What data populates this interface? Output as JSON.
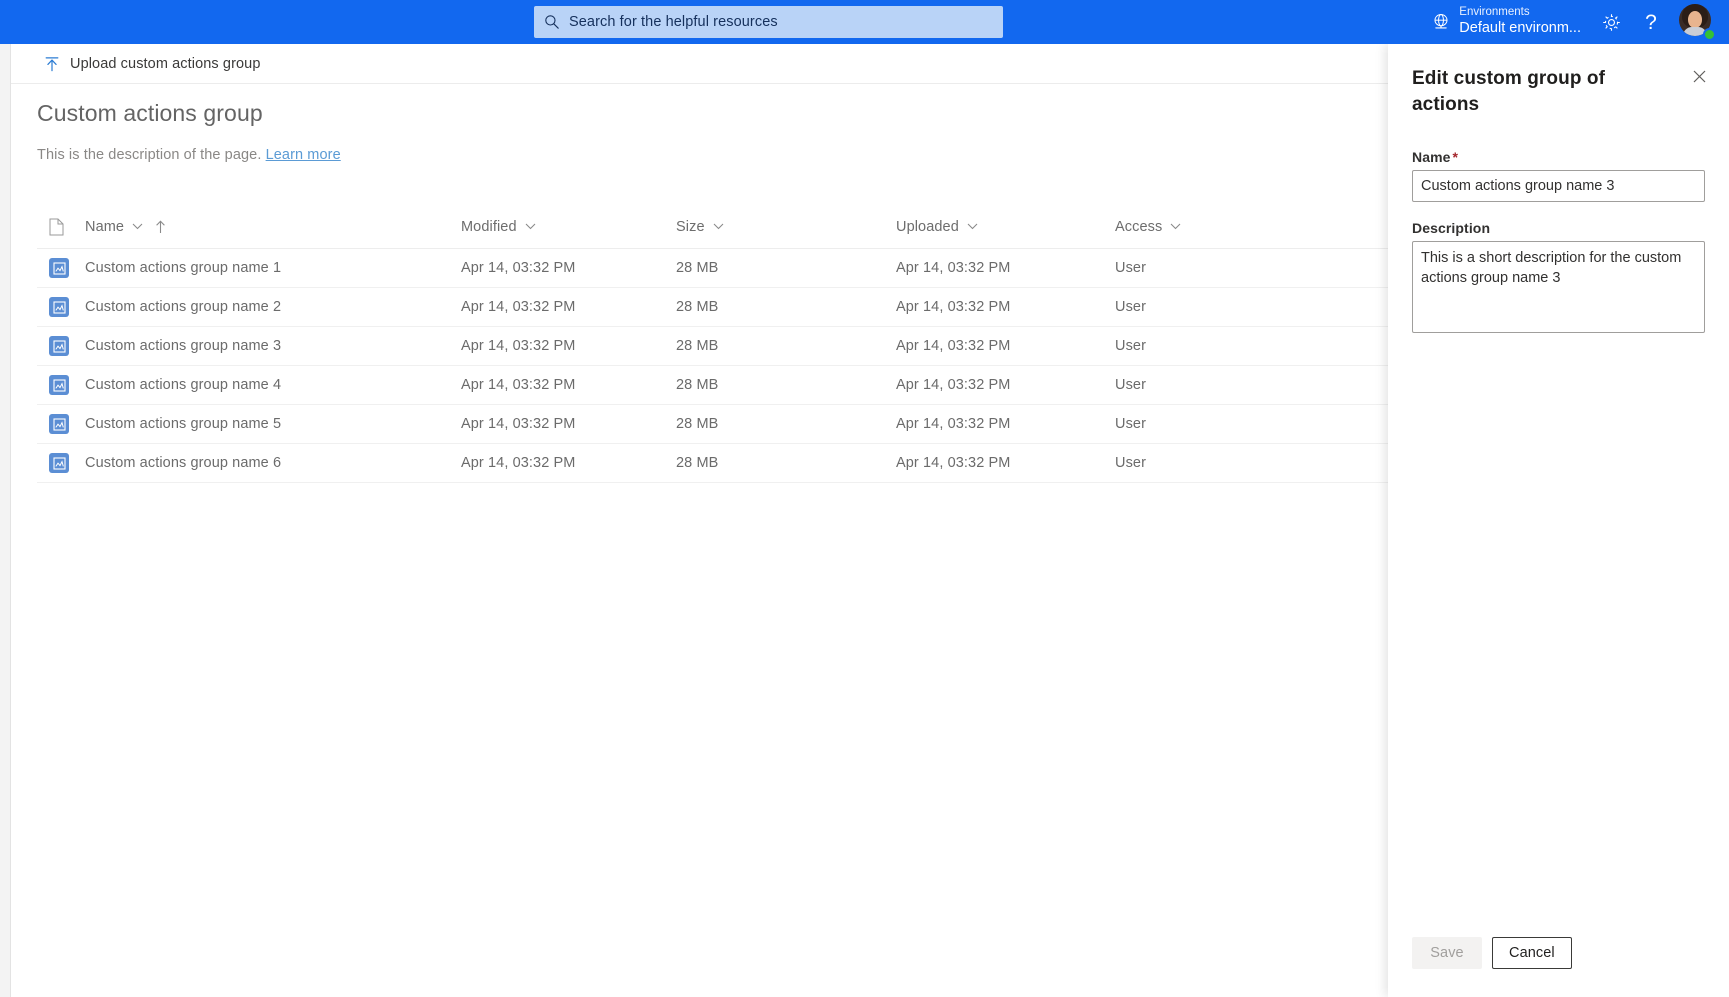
{
  "suite": {
    "search": {
      "placeholder": "Search for the helpful resources",
      "icon": "search-icon"
    },
    "environment": {
      "icon": "globe-environment-icon",
      "label": "Environments",
      "value": "Default environm..."
    },
    "settings_icon": "gear-icon",
    "help_icon": "question-mark-icon",
    "help_glyph": "?",
    "avatar": "user-avatar",
    "presence": "available-green",
    "brand_color": "#1268ef",
    "search_bg": "#b9d3f7"
  },
  "command_bar": {
    "upload": {
      "icon": "upload-icon",
      "label": "Upload custom actions group"
    }
  },
  "page": {
    "title": "Custom actions group",
    "description": "This is the description of the page.",
    "learn_more": "Learn more"
  },
  "table": {
    "columns": [
      {
        "key": "icon",
        "label": "",
        "icon": "file-type-icon",
        "sortable": false
      },
      {
        "key": "name",
        "label": "Name",
        "sorted": "ascending",
        "sort_icon": "arrow-up-icon"
      },
      {
        "key": "modified",
        "label": "Modified"
      },
      {
        "key": "size",
        "label": "Size"
      },
      {
        "key": "uploaded",
        "label": "Uploaded"
      },
      {
        "key": "access",
        "label": "Access"
      }
    ],
    "row_icon": "custom-action-group-tile-icon",
    "rows": [
      {
        "name": "Custom actions group name 1",
        "modified": "Apr 14, 03:32 PM",
        "size": "28 MB",
        "uploaded": "Apr 14, 03:32 PM",
        "access": "User"
      },
      {
        "name": "Custom actions group name 2",
        "modified": "Apr 14, 03:32 PM",
        "size": "28 MB",
        "uploaded": "Apr 14, 03:32 PM",
        "access": "User"
      },
      {
        "name": "Custom actions group name 3",
        "modified": "Apr 14, 03:32 PM",
        "size": "28 MB",
        "uploaded": "Apr 14, 03:32 PM",
        "access": "User"
      },
      {
        "name": "Custom actions group name 4",
        "modified": "Apr 14, 03:32 PM",
        "size": "28 MB",
        "uploaded": "Apr 14, 03:32 PM",
        "access": "User"
      },
      {
        "name": "Custom actions group name 5",
        "modified": "Apr 14, 03:32 PM",
        "size": "28 MB",
        "uploaded": "Apr 14, 03:32 PM",
        "access": "User"
      },
      {
        "name": "Custom actions group name 6",
        "modified": "Apr 14, 03:32 PM",
        "size": "28 MB",
        "uploaded": "Apr 14, 03:32 PM",
        "access": "User"
      }
    ]
  },
  "panel": {
    "title": "Edit custom group of actions",
    "close_icon": "close-icon",
    "name_label": "Name",
    "name_required_marker": "*",
    "name_value": "Custom actions group name 3",
    "description_label": "Description",
    "description_value": "This is a short description for the custom actions group name 3",
    "save_label": "Save",
    "cancel_label": "Cancel",
    "save_disabled": true
  }
}
